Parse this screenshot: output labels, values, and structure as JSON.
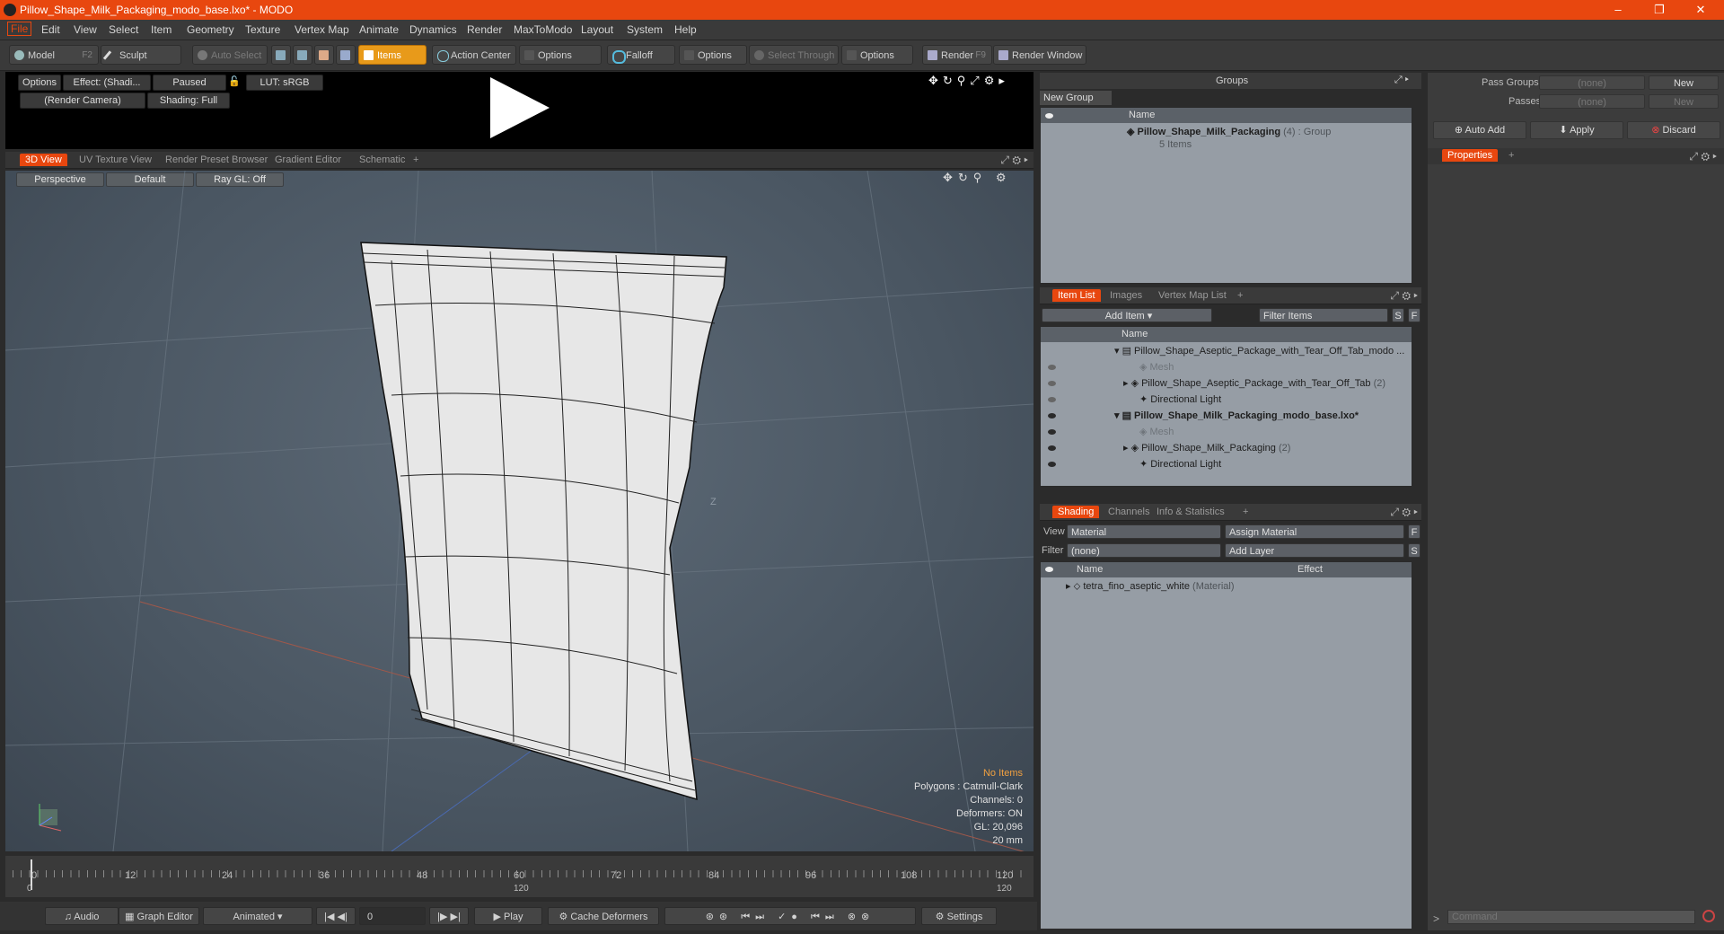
{
  "window": {
    "title": "Pillow_Shape_Milk_Packaging_modo_base.lxo* - MODO",
    "minimize": "–",
    "restore": "❐",
    "close": "✕"
  },
  "menu": [
    "File",
    "Edit",
    "View",
    "Select",
    "Item",
    "Geometry",
    "Texture",
    "Vertex Map",
    "Animate",
    "Dynamics",
    "Render",
    "MaxToModo",
    "Layout",
    "System",
    "Help"
  ],
  "toolbar": {
    "model": "Model",
    "model_key": "F2",
    "sculpt": "Sculpt",
    "auto_select": "Auto Select",
    "items": "Items",
    "action_center": "Action Center",
    "options1": "Options",
    "falloff": "Falloff",
    "options2": "Options",
    "select_through": "Select Through",
    "options3": "Options",
    "render": "Render",
    "render_key": "F9",
    "render_window": "Render Window"
  },
  "preview": {
    "options": "Options",
    "effect": "Effect: (Shadi...",
    "paused": "Paused",
    "lut": "LUT: sRGB",
    "camera": "(Render Camera)",
    "shading": "Shading: Full"
  },
  "view_tabs": [
    "3D View",
    "UV Texture View",
    "Render Preset Browser",
    "Gradient Editor",
    "Schematic",
    "+"
  ],
  "viewport": {
    "perspective": "Perspective",
    "default": "Default",
    "raygl": "Ray GL: Off",
    "axis_label": "Z",
    "info": {
      "no_items": "No Items",
      "polygons": "Polygons : Catmull-Clark",
      "channels": "Channels: 0",
      "deformers": "Deformers: ON",
      "gl": "GL: 20,096",
      "unit": "20 mm"
    }
  },
  "timeline": {
    "ticks": [
      "0",
      "12",
      "24",
      "36",
      "48",
      "60",
      "72",
      "84",
      "96",
      "108",
      "120"
    ],
    "sub_start": "0",
    "sub_mid": "120",
    "sub_end": "120"
  },
  "bottombar": {
    "audio": "Audio",
    "graph_editor": "Graph Editor",
    "animated": "Animated",
    "frame": "0",
    "play": "Play",
    "cache": "Cache Deformers",
    "settings": "Settings"
  },
  "groups": {
    "title": "Groups",
    "new_group": "New Group",
    "col_name": "Name",
    "group_name": "Pillow_Shape_Milk_Packaging",
    "group_count": "(4) : Group",
    "group_items": "5 Items"
  },
  "passes": {
    "pass_groups_label": "Pass Groups",
    "pass_groups_value": "(none)",
    "new1": "New",
    "passes_label": "Passes",
    "passes_value": "(none)",
    "new2": "New",
    "auto_add": "Auto Add",
    "apply": "Apply",
    "discard": "Discard",
    "properties_tab": "Properties",
    "plus": "+"
  },
  "itemlist": {
    "tabs": [
      "Item List",
      "Images",
      "Vertex Map List",
      "+"
    ],
    "add_item": "Add Item",
    "filter": "Filter Items",
    "s": "S",
    "f": "F",
    "col_name": "Name",
    "rows": [
      {
        "text": "Pillow_Shape_Aseptic_Package_with_Tear_Off_Tab_modo ...",
        "extra": ""
      },
      {
        "text": "Mesh",
        "extra": ""
      },
      {
        "text": "Pillow_Shape_Aseptic_Package_with_Tear_Off_Tab",
        "extra": "(2)"
      },
      {
        "text": "Directional Light",
        "extra": ""
      },
      {
        "text": "Pillow_Shape_Milk_Packaging_modo_base.lxo*",
        "extra": ""
      },
      {
        "text": "Mesh",
        "extra": ""
      },
      {
        "text": "Pillow_Shape_Milk_Packaging",
        "extra": "(2)"
      },
      {
        "text": "Directional Light",
        "extra": ""
      }
    ]
  },
  "shading": {
    "tabs": [
      "Shading",
      "Channels",
      "Info & Statistics",
      "+"
    ],
    "view_label": "View",
    "view_value": "Material",
    "assign": "Assign Material",
    "f": "F",
    "filter_label": "Filter",
    "filter_value": "(none)",
    "add_layer": "Add Layer",
    "s": "S",
    "col_name": "Name",
    "col_effect": "Effect",
    "material_name": "tetra_fino_aseptic_white",
    "material_type": "(Material)"
  },
  "command": {
    "placeholder": "Command",
    "prompt": ">"
  },
  "colors": {
    "accent": "#e8470f",
    "selected": "#e89a1a",
    "panel": "#969da5"
  }
}
